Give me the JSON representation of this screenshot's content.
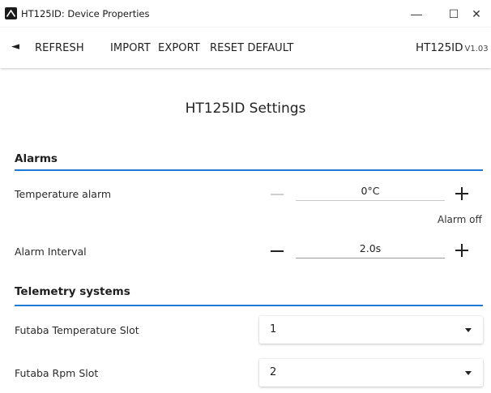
{
  "window": {
    "title": "HT125ID: Device Properties",
    "minimize": "—",
    "maximize": "☐",
    "close": "✕"
  },
  "toolbar": {
    "back": "◄",
    "refresh": "REFRESH",
    "import": "IMPORT",
    "export": "EXPORT",
    "reset": "RESET DEFAULT",
    "device_model": "HT125ID",
    "device_version": "V1.03"
  },
  "page": {
    "title": "HT125ID Settings"
  },
  "alarms": {
    "section_title": "Alarms",
    "temperature": {
      "label": "Temperature alarm",
      "value": "0°C",
      "helper": "Alarm off"
    },
    "interval": {
      "label": "Alarm Interval",
      "value": "2.0s"
    }
  },
  "telemetry": {
    "section_title": "Telemetry systems",
    "futaba_temp": {
      "label": "Futaba Temperature Slot",
      "value": "1"
    },
    "futaba_rpm": {
      "label": "Futaba Rpm Slot",
      "value": "2"
    }
  },
  "colors": {
    "accent": "#1e7ad4",
    "disabled": "#cfcfcf"
  }
}
